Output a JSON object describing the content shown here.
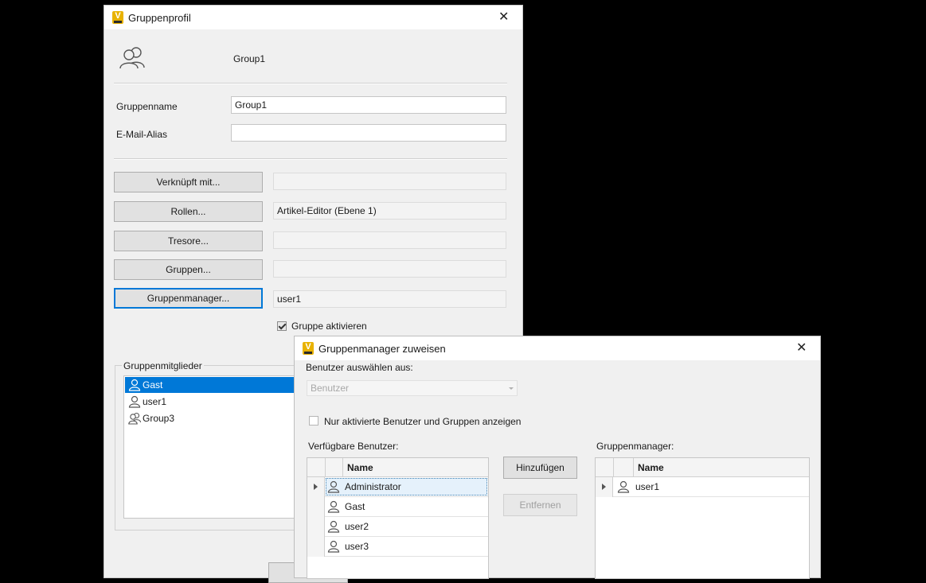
{
  "profile_window": {
    "title": "Gruppenprofil",
    "header_name": "Group1",
    "fields": {
      "group_name_label": "Gruppenname",
      "group_name_value": "Group1",
      "email_alias_label": "E-Mail-Alias",
      "email_alias_value": ""
    },
    "buttons": {
      "linked": "Verknüpft mit...",
      "roles": "Rollen...",
      "vaults": "Tresore...",
      "groups": "Gruppen...",
      "group_managers": "Gruppenmanager..."
    },
    "values": {
      "linked": "",
      "roles": "Artikel-Editor (Ebene 1)",
      "vaults": "",
      "groups": "",
      "group_managers": "user1"
    },
    "enable_group_label": "Gruppe aktivieren",
    "members_label": "Gruppenmitglieder",
    "members": [
      {
        "name": "Gast",
        "type": "user",
        "selected": true
      },
      {
        "name": "user1",
        "type": "user",
        "selected": false
      },
      {
        "name": "Group3",
        "type": "group",
        "selected": false
      }
    ]
  },
  "assign_window": {
    "title": "Gruppenmanager zuweisen",
    "select_from_label": "Benutzer auswählen aus:",
    "select_from_value": "Benutzer",
    "only_active_label": "Nur aktivierte Benutzer und Gruppen anzeigen",
    "available_label": "Verfügbare Benutzer:",
    "managers_label": "Gruppenmanager:",
    "column_name": "Name",
    "add_button": "Hinzufügen",
    "remove_button": "Entfernen",
    "available_users": [
      "Administrator",
      "Gast",
      "user2",
      "user3"
    ],
    "managers": [
      "user1"
    ]
  }
}
